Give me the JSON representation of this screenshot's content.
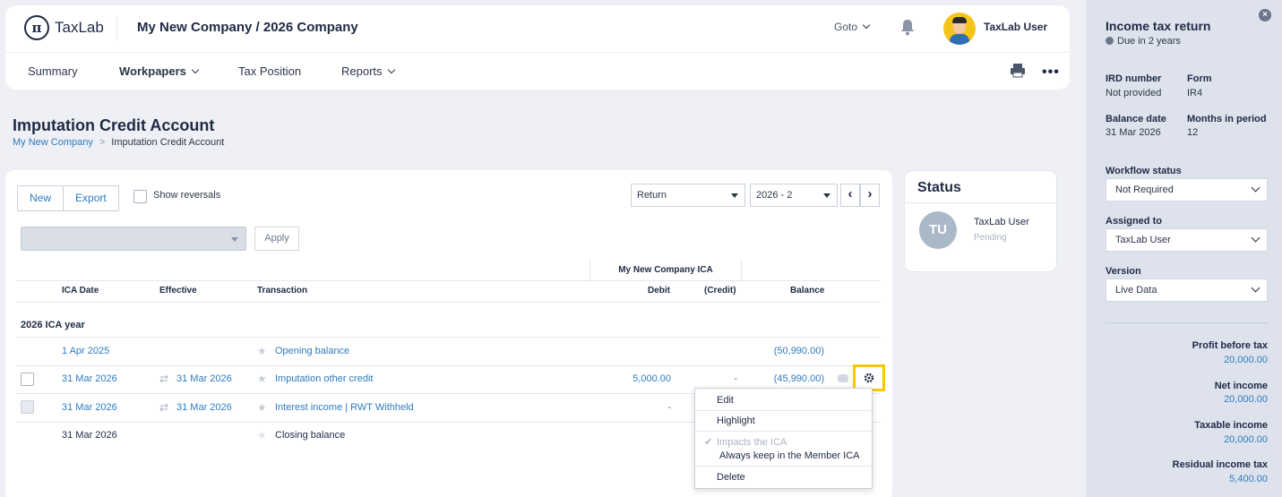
{
  "header": {
    "logo_text": "TaxLab",
    "company_title": "My New Company / 2026 Company",
    "goto_label": "Goto",
    "user_name": "TaxLab User",
    "nav": [
      {
        "label": "Summary"
      },
      {
        "label": "Workpapers"
      },
      {
        "label": "Tax Position"
      },
      {
        "label": "Reports"
      }
    ],
    "more_label": "•••"
  },
  "page": {
    "title": "Imputation Credit Account",
    "breadcrumb": [
      "My New Company",
      "Imputation Credit Account"
    ],
    "breadcrumb_sep": ">"
  },
  "toolbar": {
    "new_label": "New",
    "export_label": "Export",
    "show_reversals_label": "Show reversals",
    "return_select": "Return",
    "period_select": "2026 - 2",
    "prev_label": "‹",
    "next_label": "›",
    "filter_value": "",
    "apply_label": "Apply"
  },
  "table": {
    "group_header": "My New Company ICA",
    "columns": {
      "ica_date": "ICA Date",
      "effective": "Effective",
      "transaction": "Transaction",
      "debit": "Debit",
      "credit": "(Credit)",
      "balance": "Balance"
    },
    "year_label": "2026 ICA year",
    "rows": [
      {
        "ica_date": "1 Apr 2025",
        "effective": "",
        "transaction": "Opening balance",
        "debit": "",
        "credit": "",
        "balance": "(50,990.00)"
      },
      {
        "ica_date": "31 Mar 2026",
        "effective": "31 Mar 2026",
        "transaction": "Imputation other credit",
        "debit": "5,000.00",
        "credit": "-",
        "balance": "(45,990.00)"
      },
      {
        "ica_date": "31 Mar 2026",
        "effective": "31 Mar 2026",
        "transaction": "Interest income | RWT Withheld",
        "debit": "-",
        "credit": "",
        "balance": ""
      },
      {
        "ica_date": "31 Mar 2026",
        "effective": "",
        "transaction": "Closing balance",
        "debit": "",
        "credit": "",
        "balance": ""
      }
    ]
  },
  "context_menu": {
    "edit": "Edit",
    "highlight": "Highlight",
    "impacts_ica": "Impacts the ICA",
    "always_keep": "Always keep in the Member ICA",
    "delete": "Delete"
  },
  "status": {
    "title": "Status",
    "initials": "TU",
    "user": "TaxLab User",
    "state": "Pending"
  },
  "side": {
    "title": "Income tax return",
    "due": "Due in 2 years",
    "close_label": "×",
    "ird_label": "IRD number",
    "ird_value": "Not provided",
    "form_label": "Form",
    "form_value": "IR4",
    "balance_date_label": "Balance date",
    "balance_date_value": "31 Mar 2026",
    "months_label": "Months in period",
    "months_value": "12",
    "workflow_label": "Workflow status",
    "workflow_value": "Not Required",
    "assigned_label": "Assigned to",
    "assigned_value": "TaxLab User",
    "version_label": "Version",
    "version_value": "Live Data",
    "profit_label": "Profit before tax",
    "profit_value": "20,000.00",
    "net_label": "Net income",
    "net_value": "20,000.00",
    "taxable_label": "Taxable income",
    "taxable_value": "20,000.00",
    "residual_label": "Residual income tax",
    "residual_value": "5,400.00"
  },
  "colors": {
    "link": "#2f7bbf",
    "highlight_border": "#f5c800",
    "side_panel": "#dde2ec"
  }
}
